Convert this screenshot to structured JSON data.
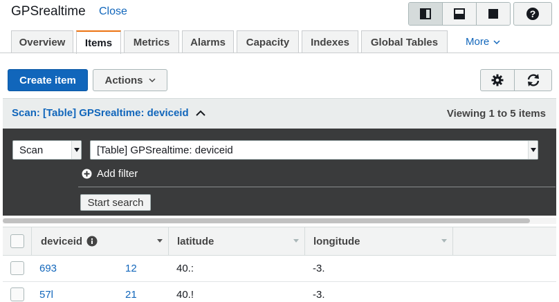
{
  "header": {
    "title": "GPSrealtime",
    "close_label": "Close",
    "layout_icons": [
      "split-left-icon",
      "split-bottom-icon",
      "full-panel-icon"
    ],
    "help_icon": "question-icon"
  },
  "tabs": [
    {
      "label": "Overview",
      "active": false
    },
    {
      "label": "Items",
      "active": true
    },
    {
      "label": "Metrics",
      "active": false
    },
    {
      "label": "Alarms",
      "active": false
    },
    {
      "label": "Capacity",
      "active": false
    },
    {
      "label": "Indexes",
      "active": false
    },
    {
      "label": "Global Tables",
      "active": false
    }
  ],
  "tabs_more": "More",
  "toolbar": {
    "create_item": "Create item",
    "actions": "Actions",
    "settings_icon": "gear-icon",
    "refresh_icon": "refresh-icon"
  },
  "scan": {
    "title": "Scan: [Table] GPSrealtime: deviceid",
    "viewing": "Viewing 1 to 5 items",
    "mode": "Scan",
    "target": "[Table] GPSrealtime: deviceid",
    "add_filter": "Add filter",
    "start_search": "Start search"
  },
  "table": {
    "columns": [
      "deviceid",
      "latitude",
      "longitude"
    ],
    "rows": [
      {
        "deviceid_a": "693",
        "deviceid_b": "12",
        "latitude": "40.:",
        "longitude": "-3."
      },
      {
        "deviceid_a": "57l",
        "deviceid_b": "21",
        "latitude": "40.!",
        "longitude": "-3."
      }
    ]
  },
  "colors": {
    "accent_blue": "#1166bb",
    "tab_orange": "#ec7211",
    "panel_dark": "#3a3b3c"
  }
}
